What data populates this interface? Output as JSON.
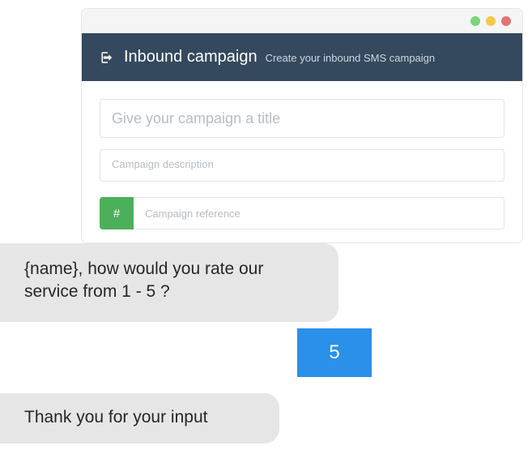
{
  "window": {
    "title": "Inbound campaign",
    "subtitle": "Create your inbound SMS campaign"
  },
  "form": {
    "title_placeholder": "Give your campaign a title",
    "description_placeholder": "Campaign description",
    "reference_prefix": "#",
    "reference_placeholder": "Campaign reference"
  },
  "chat": {
    "question": "{name}, how would you rate our service from 1 - 5 ?",
    "reply": "5",
    "thanks": "Thank you for your input"
  }
}
